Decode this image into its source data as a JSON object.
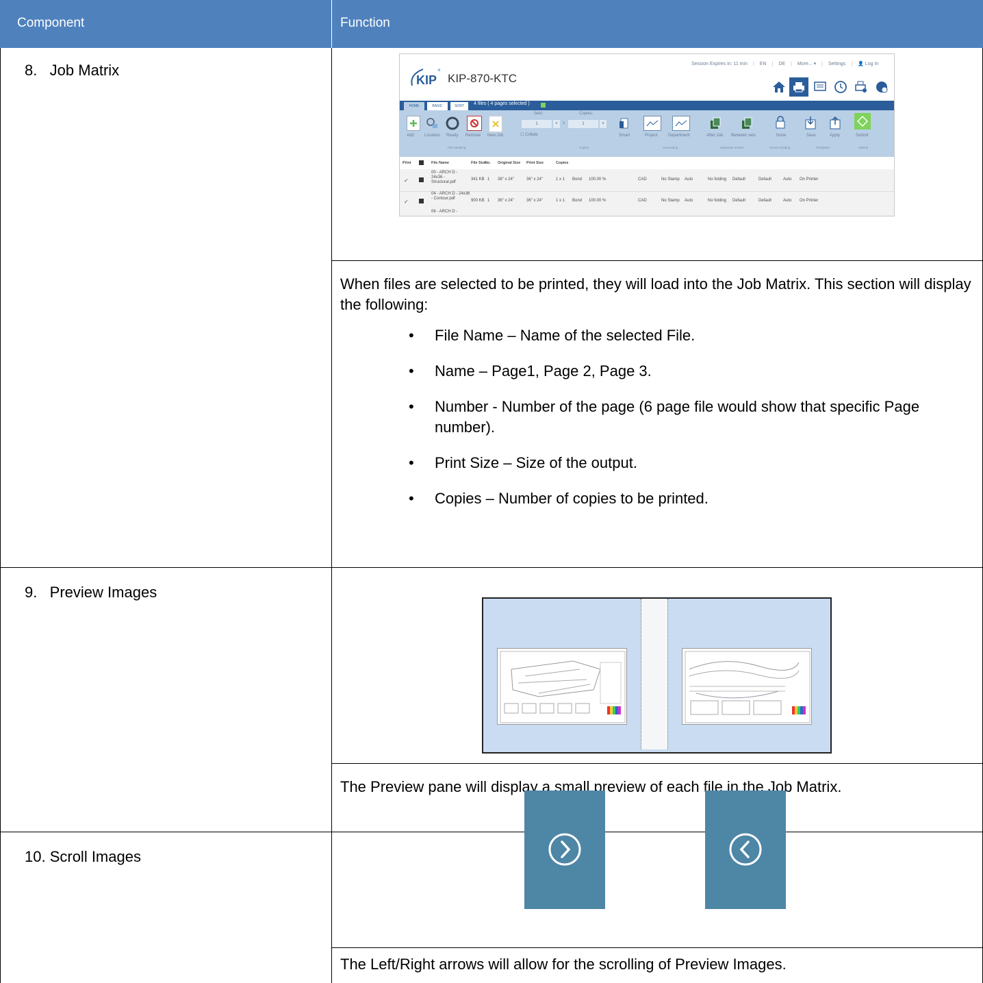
{
  "header": {
    "component": "Component",
    "function": "Function"
  },
  "rows": [
    {
      "label": "8.   Job Matrix",
      "description": "When files are selected to be printed, they will load into the Job Matrix. This section will display the following:",
      "bullets": [
        "File Name – Name of the selected File.",
        "Name – Page1, Page 2, Page 3.",
        "Number  - Number of the page (6 page file would show that specific Page number).",
        "Print Size – Size of the output.",
        "Copies – Number of copies to be printed."
      ]
    },
    {
      "label": "9.   Preview Images",
      "description": "The Preview pane will display a small preview of each file in the Job Matrix."
    },
    {
      "label": "10. Scroll Images",
      "description": "The Left/Right arrows will allow for the scrolling of Preview Images."
    }
  ],
  "kip_screenshot": {
    "logo": "KIP",
    "title": "KIP-870-KTC",
    "session": "Session Expires in: 11 min",
    "lang_en": "EN",
    "lang_de": "DE",
    "more": "More... ▾",
    "settings": "Settings",
    "login": "Log In",
    "tabs": [
      "HOME",
      "BASIC",
      "SORT"
    ],
    "files_selected": "4 files ( 4 pages selected )",
    "sets_label": "Sets:",
    "copies_label": "Copies:",
    "sets_value": "1",
    "copies_value": "1",
    "collate": "Collate",
    "toolbar": [
      "Add",
      "Location",
      "Ready",
      "Remove",
      "New Job",
      "Smart",
      "Project",
      "Department",
      "After Job",
      "Between sets",
      "None",
      "Save",
      "Apply",
      "Submit"
    ],
    "groups": [
      "File Handling",
      "Copies",
      "Accounting",
      "Separator sheets",
      "Secure printing",
      "Templates",
      "Submit"
    ],
    "columns": [
      "Print",
      "File Name",
      "File Size",
      "No.",
      "Original Size",
      "Print Size",
      "Copies"
    ],
    "file_rows": [
      {
        "name": "00 - ARCH D - 24x36 - Structural.pdf",
        "size": "341 KB",
        "no": "1",
        "orig": "36\" x 24\"",
        "print": "36\" x 24\"",
        "copies": "1 x 1",
        "media": "Bond",
        "scale": "100.00 %",
        "type": "CAD",
        "stamp": "No Stamp",
        "auto": "Auto",
        "fold": "No folding",
        "def1": "Default",
        "def2": "Default",
        "auto2": "Auto",
        "dest": "On Printer"
      },
      {
        "name": "04 - ARCH D - 24x36 - Contour.pdf",
        "size": "900 KB",
        "no": "1",
        "orig": "36\" x 24\"",
        "print": "36\" x 24\"",
        "copies": "1 x 1",
        "media": "Bond",
        "scale": "100.00 %",
        "type": "CAD",
        "stamp": "No Stamp",
        "auto": "Auto",
        "fold": "No folding",
        "def1": "Default",
        "def2": "Default",
        "auto2": "Auto",
        "dest": "On Printer"
      },
      {
        "name": "06 - ARCH D -"
      }
    ]
  },
  "colors": {
    "header_bg": "#4f81bd",
    "kip_blue": "#2a5d9a",
    "ribbon_bg": "#b8cfe6",
    "preview_bg": "#c9dcf2",
    "scroll_btn": "#4e86a6"
  }
}
